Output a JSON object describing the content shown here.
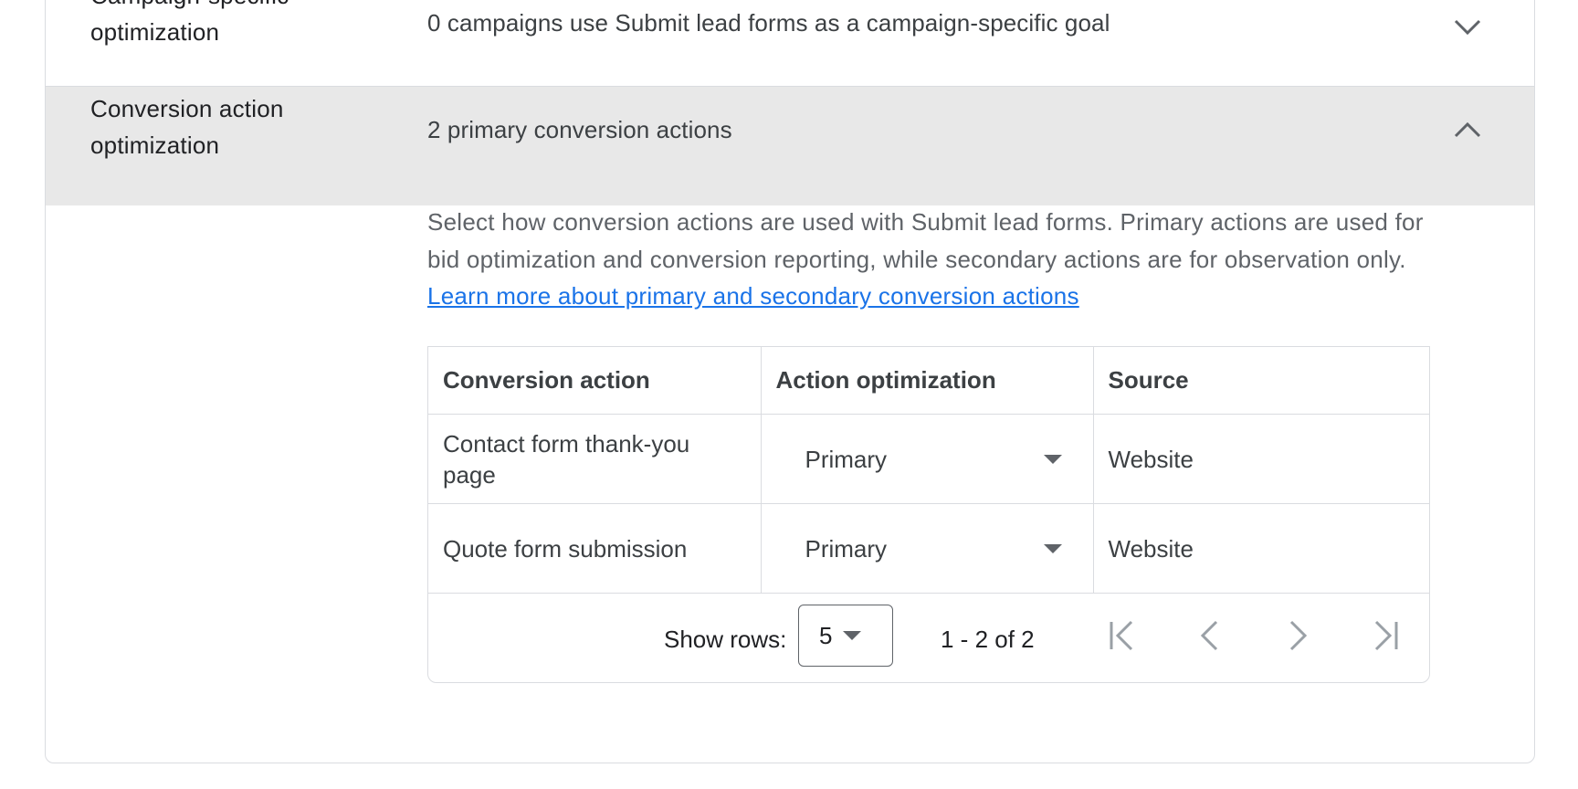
{
  "campaign_row": {
    "label_line1": "Campaign-specific",
    "label_line2": "optimization",
    "summary": "0 campaigns use Submit lead forms as a campaign-specific goal",
    "chevron_icon": "chevron-down-icon"
  },
  "conversion_row": {
    "label_line1": "Conversion action",
    "label_line2": "optimization",
    "summary": "2 primary conversion actions",
    "chevron_icon": "chevron-up-icon"
  },
  "description": {
    "text": "Select how conversion actions are used with Submit lead forms. Primary actions are used for bid optimization and conversion reporting, while secondary actions are for observation only.",
    "link_text": "Learn more about primary and secondary conversion actions"
  },
  "table": {
    "headers": [
      "Conversion action",
      "Action optimization",
      "Source"
    ],
    "rows": [
      {
        "conversion_action": "Contact form thank-you page",
        "action_optimization": "Primary",
        "source": "Website"
      },
      {
        "conversion_action": "Quote form submission",
        "action_optimization": "Primary",
        "source": "Website"
      }
    ]
  },
  "pagination": {
    "show_rows_label": "Show rows:",
    "rows_per_page": "5",
    "range_text": "1 - 2 of 2",
    "icons": [
      "first-page-icon",
      "previous-page-icon",
      "next-page-icon",
      "last-page-icon"
    ]
  },
  "colors": {
    "link": "#1a73e8",
    "expanded_row_bg": "#e8e8e8",
    "border": "#dadce0",
    "pager_icon_disabled": "#9aa0a6"
  }
}
